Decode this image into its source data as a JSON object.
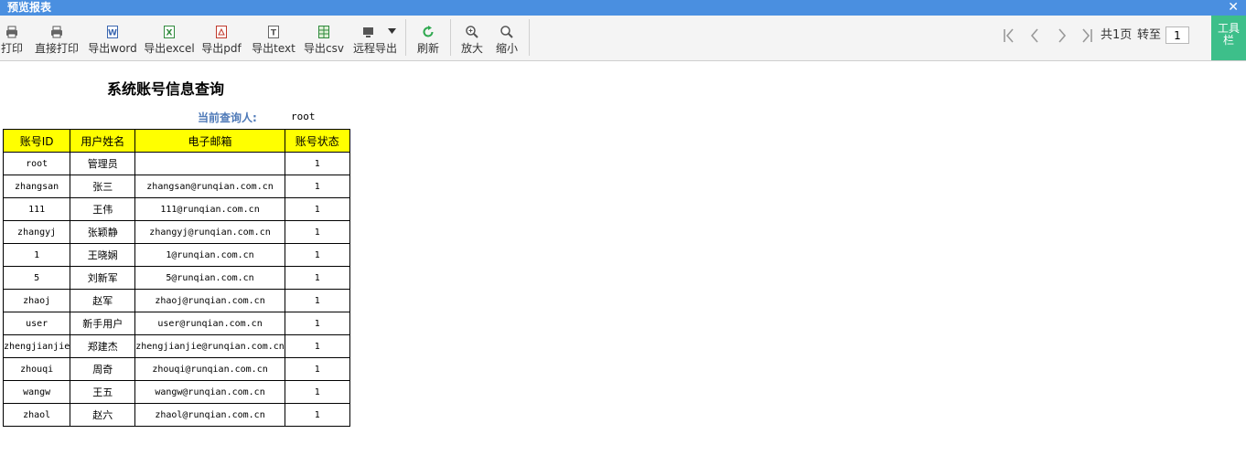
{
  "window": {
    "title": "预览报表",
    "close_label": "✕"
  },
  "toolbar": {
    "buttons": [
      {
        "label": "打印",
        "icon": "printer-icon"
      },
      {
        "label": "直接打印",
        "icon": "printer-icon"
      },
      {
        "label": "导出word",
        "icon": "word-icon"
      },
      {
        "label": "导出excel",
        "icon": "excel-icon"
      },
      {
        "label": "导出pdf",
        "icon": "pdf-icon"
      },
      {
        "label": "导出text",
        "icon": "text-icon"
      },
      {
        "label": "导出csv",
        "icon": "csv-icon"
      },
      {
        "label": "远程导出",
        "icon": "remote-export-icon"
      },
      {
        "label": "刷新",
        "icon": "refresh-icon"
      },
      {
        "label": "放大",
        "icon": "zoom-in-icon"
      },
      {
        "label": "缩小",
        "icon": "zoom-out-icon"
      }
    ],
    "pager": {
      "total_text": "共1页",
      "goto_label": "转至",
      "current_page": "1"
    },
    "toolbox_label": "工具栏"
  },
  "report": {
    "title": "系统账号信息查询",
    "query_label": "当前查询人:",
    "query_user": "root",
    "columns": [
      "账号ID",
      "用户姓名",
      "电子邮箱",
      "账号状态"
    ],
    "rows": [
      [
        "root",
        "管理员",
        "",
        "1"
      ],
      [
        "zhangsan",
        "张三",
        "zhangsan@runqian.com.cn",
        "1"
      ],
      [
        "111",
        "王伟",
        "111@runqian.com.cn",
        "1"
      ],
      [
        "zhangyj",
        "张颖静",
        "zhangyj@runqian.com.cn",
        "1"
      ],
      [
        "1",
        "王晓娴",
        "1@runqian.com.cn",
        "1"
      ],
      [
        "5",
        "刘新军",
        "5@runqian.com.cn",
        "1"
      ],
      [
        "zhaoj",
        "赵军",
        "zhaoj@runqian.com.cn",
        "1"
      ],
      [
        "user",
        "新手用户",
        "user@runqian.com.cn",
        "1"
      ],
      [
        "zhengjianjie",
        "郑建杰",
        "zhengjianjie@runqian.com.cn",
        "1"
      ],
      [
        "zhouqi",
        "周奇",
        "zhouqi@runqian.com.cn",
        "1"
      ],
      [
        "wangw",
        "王五",
        "wangw@runqian.com.cn",
        "1"
      ],
      [
        "zhaol",
        "赵六",
        "zhaol@runqian.com.cn",
        "1"
      ]
    ]
  },
  "colors": {
    "titlebar": "#4a8fe0",
    "header_fill": "#ffff00",
    "toolbox": "#3dbf8a",
    "query_label": "#4f7ab8"
  }
}
